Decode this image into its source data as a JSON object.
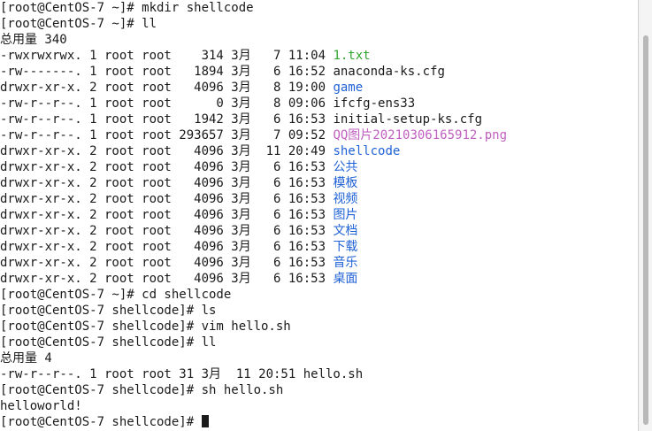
{
  "colors": {
    "background": "#ffffff",
    "text": "#1a1a1a",
    "txt_file": "#2fa52f",
    "directory": "#1f62d6",
    "image_file": "#c060c0"
  },
  "terminal": {
    "lines": [
      {
        "text": "[root@CentOS-7 ~]# mkdir shellcode"
      },
      {
        "text": "[root@CentOS-7 ~]# ll"
      },
      {
        "text": "总用量 340"
      },
      {
        "text": "-rwxrwxrwx. 1 root root    314 3月   7 11:04 ",
        "name": "1.txt",
        "color": "green"
      },
      {
        "text": "-rw-------. 1 root root   1894 3月   6 16:52 ",
        "name": "anaconda-ks.cfg"
      },
      {
        "text": "drwxr-xr-x. 2 root root   4096 3月   8 19:00 ",
        "name": "game",
        "color": "blue"
      },
      {
        "text": "-rw-r--r--. 1 root root      0 3月   8 09:06 ",
        "name": "ifcfg-ens33"
      },
      {
        "text": "-rw-r--r--. 1 root root   1942 3月   6 16:53 ",
        "name": "initial-setup-ks.cfg"
      },
      {
        "text": "-rw-r--r--. 1 root root 293657 3月   7 09:52 ",
        "name": "QQ图片20210306165912.png",
        "color": "magenta"
      },
      {
        "text": "drwxr-xr-x. 2 root root   4096 3月  11 20:49 ",
        "name": "shellcode",
        "color": "blue"
      },
      {
        "text": "drwxr-xr-x. 2 root root   4096 3月   6 16:53 ",
        "name": "公共",
        "color": "blue"
      },
      {
        "text": "drwxr-xr-x. 2 root root   4096 3月   6 16:53 ",
        "name": "模板",
        "color": "blue"
      },
      {
        "text": "drwxr-xr-x. 2 root root   4096 3月   6 16:53 ",
        "name": "视频",
        "color": "blue"
      },
      {
        "text": "drwxr-xr-x. 2 root root   4096 3月   6 16:53 ",
        "name": "图片",
        "color": "blue"
      },
      {
        "text": "drwxr-xr-x. 2 root root   4096 3月   6 16:53 ",
        "name": "文档",
        "color": "blue"
      },
      {
        "text": "drwxr-xr-x. 2 root root   4096 3月   6 16:53 ",
        "name": "下载",
        "color": "blue"
      },
      {
        "text": "drwxr-xr-x. 2 root root   4096 3月   6 16:53 ",
        "name": "音乐",
        "color": "blue"
      },
      {
        "text": "drwxr-xr-x. 2 root root   4096 3月   6 16:53 ",
        "name": "桌面",
        "color": "blue"
      },
      {
        "text": "[root@CentOS-7 ~]# cd shellcode"
      },
      {
        "text": "[root@CentOS-7 shellcode]# ls"
      },
      {
        "text": "[root@CentOS-7 shellcode]# vim hello.sh"
      },
      {
        "text": "[root@CentOS-7 shellcode]# ll"
      },
      {
        "text": "总用量 4"
      },
      {
        "text": "-rw-r--r--. 1 root root 31 3月  11 20:51 hello.sh"
      },
      {
        "text": "[root@CentOS-7 shellcode]# sh hello.sh"
      },
      {
        "text": "helloworld!"
      },
      {
        "text": "[root@CentOS-7 shellcode]# ",
        "cursor": true
      }
    ]
  }
}
